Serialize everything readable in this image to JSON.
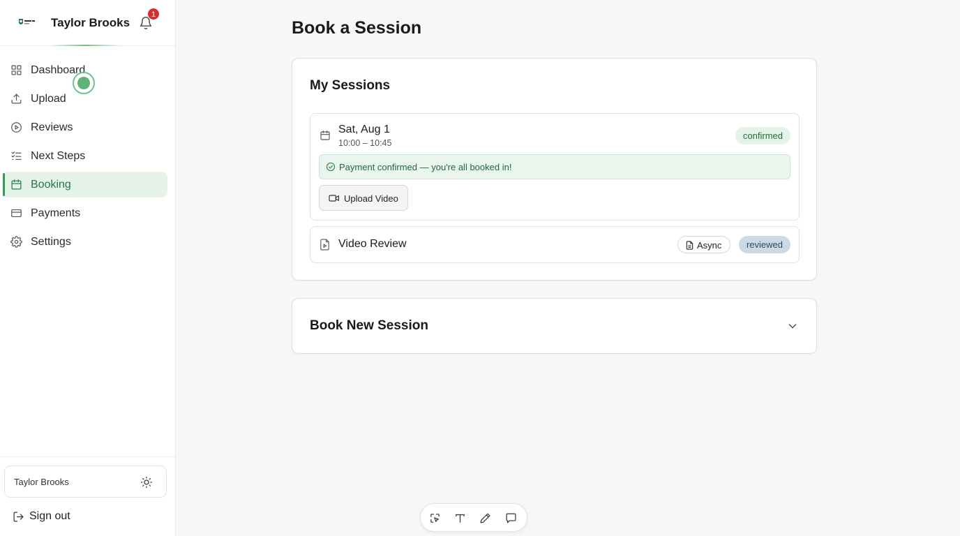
{
  "sidebar": {
    "user_name": "Taylor Brooks",
    "notification_count": "1",
    "items": [
      {
        "label": "Dashboard",
        "icon": "grid-icon"
      },
      {
        "label": "Upload",
        "icon": "upload-icon"
      },
      {
        "label": "Reviews",
        "icon": "play-circle-icon"
      },
      {
        "label": "Next Steps",
        "icon": "checklist-icon"
      },
      {
        "label": "Booking",
        "icon": "calendar-icon",
        "active": true
      },
      {
        "label": "Payments",
        "icon": "credit-card-icon"
      },
      {
        "label": "Settings",
        "icon": "gear-icon"
      }
    ],
    "footer_user": "Taylor Brooks",
    "sign_out": "Sign out"
  },
  "main": {
    "title": "Book a Session",
    "my_sessions": {
      "title": "My Sessions",
      "sessions": [
        {
          "date": "Sat, Aug 1",
          "time": "10:00 – 10:45",
          "status": "confirmed",
          "banner": "Payment confirmed — you're all booked in!",
          "action": "Upload Video"
        },
        {
          "title": "Video Review",
          "type": "Async",
          "status": "reviewed"
        }
      ]
    },
    "book_new": {
      "title": "Book New Session"
    }
  },
  "colors": {
    "accent": "#2f9c58",
    "active_bg": "#e6f3e9",
    "confirmed_bg": "#e4f4e8",
    "reviewed_bg": "#cdd9e3",
    "badge_red": "#d32f2f"
  },
  "toolbar": {
    "icons": [
      "select-icon",
      "text-icon",
      "pencil-icon",
      "comment-icon"
    ]
  }
}
